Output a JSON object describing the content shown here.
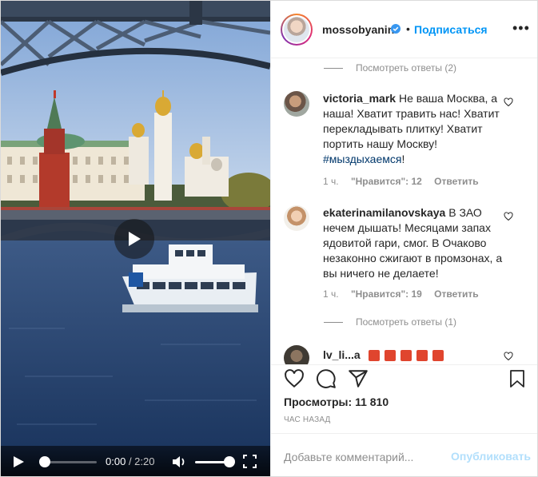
{
  "video": {
    "current_time": "0:00",
    "duration": "2:20",
    "progress": 0.0,
    "volume": 1.0
  },
  "header": {
    "username": "mossobyanin",
    "separator": "•",
    "follow_label": "Подписаться",
    "more_label": "•••"
  },
  "comments": {
    "replies_top": "Посмотреть ответы (2)",
    "items": [
      {
        "username": "victoria_mark",
        "text": "Не ваша Москва, а наша! Хватит травить нас! Хватит перекладывать плитку! Хватит портить нашу Москву!",
        "hashtag": "#мыздыхаемся",
        "tail": "!",
        "time": "1 ч.",
        "likes": "\"Нравится\": 12",
        "reply": "Ответить"
      },
      {
        "username": "ekaterinamilanovskaya",
        "text": "В ЗАО нечем дышать! Месяцами запах ядовитой гари, смог. В Очаково незаконно сжигают в промзонах, а вы ничего не делаете!",
        "time": "1 ч.",
        "likes": "\"Нравится\": 19",
        "reply": "Ответить"
      }
    ],
    "replies_bottom": "Посмотреть ответы (1)",
    "partial_username": "lv_li...a"
  },
  "stats": {
    "views_label": "Просмотры:",
    "views_value": "11 810",
    "time_ago": "ЧАС НАЗАД"
  },
  "composer": {
    "placeholder": "Добавьте комментарий...",
    "post_label": "Опубликовать"
  },
  "colors": {
    "accent": "#0095f6",
    "muted": "#8e8e8e",
    "text": "#262626",
    "hashtag": "#00376b"
  }
}
